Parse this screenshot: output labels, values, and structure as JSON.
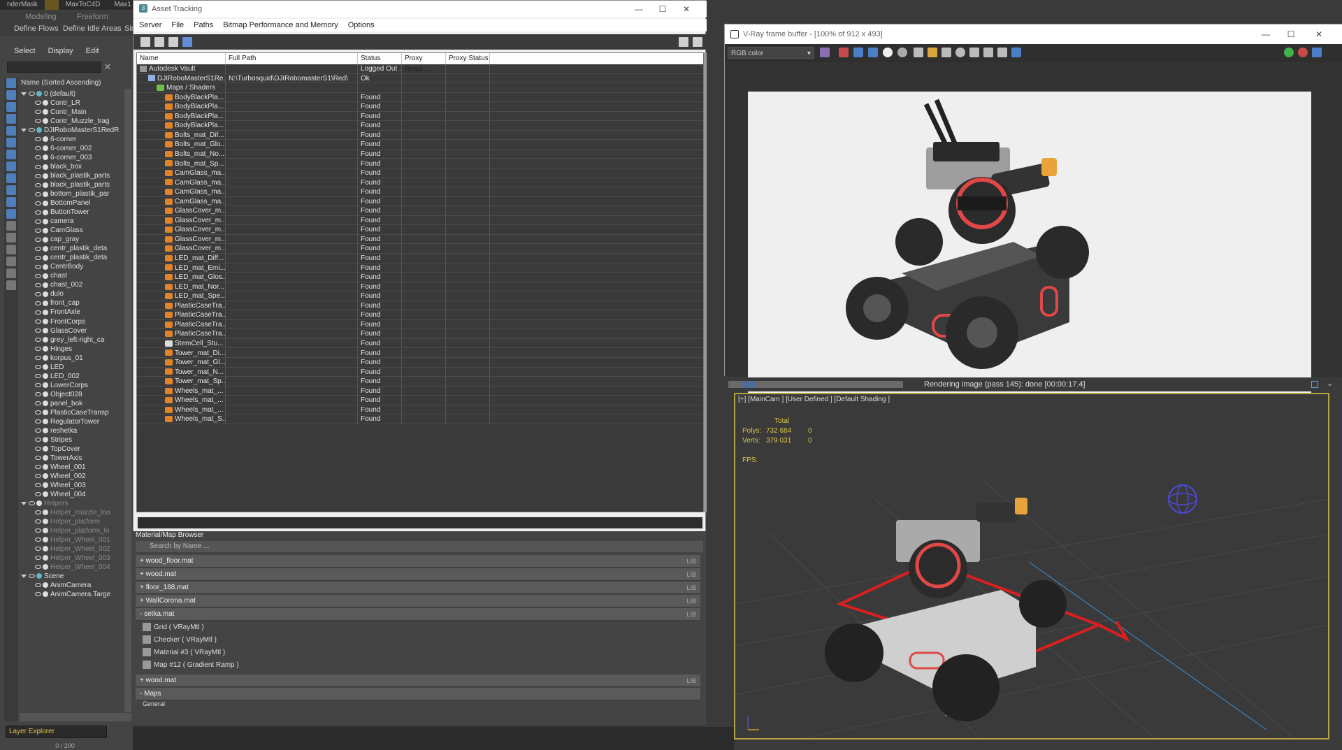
{
  "ribbon": {
    "tabs": [
      "nderMask",
      "",
      "MaxToC4D",
      "Max1"
    ],
    "sub_tabs": [
      "Modeling",
      "Freeform",
      "Define Flows",
      "Define Idle Areas",
      "Sir"
    ]
  },
  "explorer": {
    "menu": [
      "Select",
      "Display",
      "Edit"
    ],
    "header": "Name (Sorted Ascending)",
    "items": [
      {
        "label": "0 (default)",
        "level": 1,
        "type": "layer"
      },
      {
        "label": "Contr_LR",
        "level": 2,
        "type": "obj"
      },
      {
        "label": "Contr_Main",
        "level": 2,
        "type": "obj"
      },
      {
        "label": "Contr_Muzzle_trag",
        "level": 2,
        "type": "obj"
      },
      {
        "label": "DJIRoboMasterS1RedR",
        "level": 1,
        "type": "layer"
      },
      {
        "label": "6-corner",
        "level": 2,
        "type": "obj"
      },
      {
        "label": "6-corner_002",
        "level": 2,
        "type": "obj"
      },
      {
        "label": "6-corner_003",
        "level": 2,
        "type": "obj"
      },
      {
        "label": "black_box",
        "level": 2,
        "type": "obj"
      },
      {
        "label": "black_plastik_parts",
        "level": 2,
        "type": "obj"
      },
      {
        "label": "black_plastik_parts",
        "level": 2,
        "type": "obj"
      },
      {
        "label": "bottom_plastik_par",
        "level": 2,
        "type": "obj"
      },
      {
        "label": "BottomPanel",
        "level": 2,
        "type": "obj"
      },
      {
        "label": "ButtonTower",
        "level": 2,
        "type": "obj"
      },
      {
        "label": "camera",
        "level": 2,
        "type": "obj"
      },
      {
        "label": "CamGlass",
        "level": 2,
        "type": "obj"
      },
      {
        "label": "cap_gray",
        "level": 2,
        "type": "obj"
      },
      {
        "label": "centr_plastik_deta",
        "level": 2,
        "type": "obj"
      },
      {
        "label": "centr_plastik_deta",
        "level": 2,
        "type": "obj"
      },
      {
        "label": "CentrBody",
        "level": 2,
        "type": "obj"
      },
      {
        "label": "chast",
        "level": 2,
        "type": "obj"
      },
      {
        "label": "chast_002",
        "level": 2,
        "type": "obj"
      },
      {
        "label": "dulo",
        "level": 2,
        "type": "obj"
      },
      {
        "label": "front_cap",
        "level": 2,
        "type": "obj"
      },
      {
        "label": "FrontAxle",
        "level": 2,
        "type": "obj"
      },
      {
        "label": "FrontCorps",
        "level": 2,
        "type": "obj"
      },
      {
        "label": "GlassCover",
        "level": 2,
        "type": "obj"
      },
      {
        "label": "grey_left-right_ca",
        "level": 2,
        "type": "obj"
      },
      {
        "label": "Hinges",
        "level": 2,
        "type": "obj"
      },
      {
        "label": "korpus_01",
        "level": 2,
        "type": "obj"
      },
      {
        "label": "LED",
        "level": 2,
        "type": "obj"
      },
      {
        "label": "LED_002",
        "level": 2,
        "type": "obj"
      },
      {
        "label": "LowerCorps",
        "level": 2,
        "type": "obj"
      },
      {
        "label": "Object028",
        "level": 2,
        "type": "obj"
      },
      {
        "label": "panel_bok",
        "level": 2,
        "type": "obj"
      },
      {
        "label": "PlasticCaseTransp",
        "level": 2,
        "type": "obj"
      },
      {
        "label": "RegulatorTower",
        "level": 2,
        "type": "obj"
      },
      {
        "label": "reshetka",
        "level": 2,
        "type": "obj"
      },
      {
        "label": "Stripes",
        "level": 2,
        "type": "obj"
      },
      {
        "label": "TopCover",
        "level": 2,
        "type": "obj"
      },
      {
        "label": "TowerAxis",
        "level": 2,
        "type": "obj"
      },
      {
        "label": "Wheel_001",
        "level": 2,
        "type": "obj"
      },
      {
        "label": "Wheel_002",
        "level": 2,
        "type": "obj"
      },
      {
        "label": "Wheel_003",
        "level": 2,
        "type": "obj"
      },
      {
        "label": "Wheel_004",
        "level": 2,
        "type": "obj"
      },
      {
        "label": "Helpers",
        "level": 1,
        "type": "layer-dim"
      },
      {
        "label": "Helper_muzzle_loo",
        "level": 2,
        "type": "dim"
      },
      {
        "label": "Helper_platform",
        "level": 2,
        "type": "dim"
      },
      {
        "label": "Helper_platform_lo",
        "level": 2,
        "type": "dim"
      },
      {
        "label": "Helper_Wheel_001",
        "level": 2,
        "type": "dim"
      },
      {
        "label": "Helper_Wheel_002",
        "level": 2,
        "type": "dim"
      },
      {
        "label": "Helper_Wheel_003",
        "level": 2,
        "type": "dim"
      },
      {
        "label": "Helper_Wheel_004",
        "level": 2,
        "type": "dim"
      },
      {
        "label": "Scene",
        "level": 1,
        "type": "layer"
      },
      {
        "label": "AnimCamera",
        "level": 2,
        "type": "obj"
      },
      {
        "label": "AnimCamera.Targe",
        "level": 2,
        "type": "obj"
      }
    ],
    "layer_dropdown": "Layer Explorer",
    "count": "0 / 200"
  },
  "asset": {
    "title": "Asset Tracking",
    "menu": [
      "Server",
      "File",
      "Paths",
      "Bitmap Performance and Memory",
      "Options"
    ],
    "columns": [
      "Name",
      "Full Path",
      "Status",
      "Proxy Resol...",
      "Proxy Status"
    ],
    "rows": [
      {
        "name": "Autodesk Vault",
        "path": "",
        "status": "Logged Out ...",
        "indent": 1,
        "icon": "vault"
      },
      {
        "name": "DJIRoboMasterS1Re...",
        "path": "N:\\Turbosquid\\DJIRobomasterS1\\Red\\",
        "status": "Ok",
        "indent": 2,
        "icon": "file"
      },
      {
        "name": "Maps / Shaders",
        "path": "",
        "status": "",
        "indent": 3,
        "icon": "folder"
      },
      {
        "name": "BodyBlackPla...",
        "path": "",
        "status": "Found",
        "indent": 4,
        "icon": "mat"
      },
      {
        "name": "BodyBlackPla...",
        "path": "",
        "status": "Found",
        "indent": 4,
        "icon": "mat"
      },
      {
        "name": "BodyBlackPla...",
        "path": "",
        "status": "Found",
        "indent": 4,
        "icon": "mat"
      },
      {
        "name": "BodyBlackPla...",
        "path": "",
        "status": "Found",
        "indent": 4,
        "icon": "mat"
      },
      {
        "name": "Bolts_mat_Dif...",
        "path": "",
        "status": "Found",
        "indent": 4,
        "icon": "mat"
      },
      {
        "name": "Bolts_mat_Glo...",
        "path": "",
        "status": "Found",
        "indent": 4,
        "icon": "mat"
      },
      {
        "name": "Bolts_mat_No...",
        "path": "",
        "status": "Found",
        "indent": 4,
        "icon": "mat"
      },
      {
        "name": "Bolts_mat_Sp...",
        "path": "",
        "status": "Found",
        "indent": 4,
        "icon": "mat"
      },
      {
        "name": "CamGlass_ma...",
        "path": "",
        "status": "Found",
        "indent": 4,
        "icon": "mat"
      },
      {
        "name": "CamGlass_ma...",
        "path": "",
        "status": "Found",
        "indent": 4,
        "icon": "mat"
      },
      {
        "name": "CamGlass_ma...",
        "path": "",
        "status": "Found",
        "indent": 4,
        "icon": "mat"
      },
      {
        "name": "CamGlass_ma...",
        "path": "",
        "status": "Found",
        "indent": 4,
        "icon": "mat"
      },
      {
        "name": "GlassCover_m...",
        "path": "",
        "status": "Found",
        "indent": 4,
        "icon": "mat"
      },
      {
        "name": "GlassCover_m...",
        "path": "",
        "status": "Found",
        "indent": 4,
        "icon": "mat"
      },
      {
        "name": "GlassCover_m...",
        "path": "",
        "status": "Found",
        "indent": 4,
        "icon": "mat"
      },
      {
        "name": "GlassCover_m...",
        "path": "",
        "status": "Found",
        "indent": 4,
        "icon": "mat"
      },
      {
        "name": "GlassCover_m...",
        "path": "",
        "status": "Found",
        "indent": 4,
        "icon": "mat"
      },
      {
        "name": "LED_mat_Diff...",
        "path": "",
        "status": "Found",
        "indent": 4,
        "icon": "mat"
      },
      {
        "name": "LED_mat_Emi...",
        "path": "",
        "status": "Found",
        "indent": 4,
        "icon": "mat"
      },
      {
        "name": "LED_mat_Glos...",
        "path": "",
        "status": "Found",
        "indent": 4,
        "icon": "mat"
      },
      {
        "name": "LED_mat_Nor...",
        "path": "",
        "status": "Found",
        "indent": 4,
        "icon": "mat"
      },
      {
        "name": "LED_mat_Spe...",
        "path": "",
        "status": "Found",
        "indent": 4,
        "icon": "mat"
      },
      {
        "name": "PlasticCaseTra...",
        "path": "",
        "status": "Found",
        "indent": 4,
        "icon": "mat"
      },
      {
        "name": "PlasticCaseTra...",
        "path": "",
        "status": "Found",
        "indent": 4,
        "icon": "mat"
      },
      {
        "name": "PlasticCaseTra...",
        "path": "",
        "status": "Found",
        "indent": 4,
        "icon": "mat"
      },
      {
        "name": "PlasticCaseTra...",
        "path": "",
        "status": "Found",
        "indent": 4,
        "icon": "mat"
      },
      {
        "name": "StemCell_Stu...",
        "path": "",
        "status": "Found",
        "indent": 4,
        "icon": "white"
      },
      {
        "name": "Tower_mat_Di...",
        "path": "",
        "status": "Found",
        "indent": 4,
        "icon": "mat"
      },
      {
        "name": "Tower_mat_Gl...",
        "path": "",
        "status": "Found",
        "indent": 4,
        "icon": "mat"
      },
      {
        "name": "Tower_mat_N...",
        "path": "",
        "status": "Found",
        "indent": 4,
        "icon": "mat"
      },
      {
        "name": "Tower_mat_Sp...",
        "path": "",
        "status": "Found",
        "indent": 4,
        "icon": "mat"
      },
      {
        "name": "Wheels_mat_...",
        "path": "",
        "status": "Found",
        "indent": 4,
        "icon": "mat"
      },
      {
        "name": "Wheels_mat_...",
        "path": "",
        "status": "Found",
        "indent": 4,
        "icon": "mat"
      },
      {
        "name": "Wheels_mat_...",
        "path": "",
        "status": "Found",
        "indent": 4,
        "icon": "mat"
      },
      {
        "name": "Wheels_mat_S...",
        "path": "",
        "status": "Found",
        "indent": 4,
        "icon": "mat"
      }
    ]
  },
  "mat_browser": {
    "title": "Material/Map Browser",
    "search_placeholder": "Search by Name ...",
    "libs": [
      {
        "label": "+ wood_floor.mat",
        "tag": "LIB"
      },
      {
        "label": "+ wood.mat",
        "tag": "LIB"
      },
      {
        "label": "+ floor_188.mat",
        "tag": "LIB"
      },
      {
        "label": "+ WallCorona.mat",
        "tag": "LIB"
      },
      {
        "label": "- setka.mat",
        "tag": "LIB"
      }
    ],
    "setka_items": [
      "Grid  ( VRayMtl )",
      "Checker  ( VRayMtl )",
      "Material #3  ( VRayMtl )",
      "Map #12  ( Gradient Ramp )"
    ],
    "wood2": {
      "label": "+ wood.mat",
      "tag": "LIB"
    },
    "maps": "- Maps",
    "general": "General"
  },
  "vray": {
    "title": "V-Ray frame buffer - [100% of 912 x 493]",
    "channel": "RGB color"
  },
  "status": {
    "message": "Rendering image (pass 145): done [00:00:17.4]"
  },
  "viewport": {
    "label": "[+] [MainCam ] [User Defined ] [Default Shading ]",
    "total": "Total",
    "polys_label": "Polys:",
    "polys": "732 684",
    "polys_sel": "0",
    "verts_label": "Verts:",
    "verts": "379 031",
    "verts_sel": "0",
    "fps_label": "FPS:"
  }
}
